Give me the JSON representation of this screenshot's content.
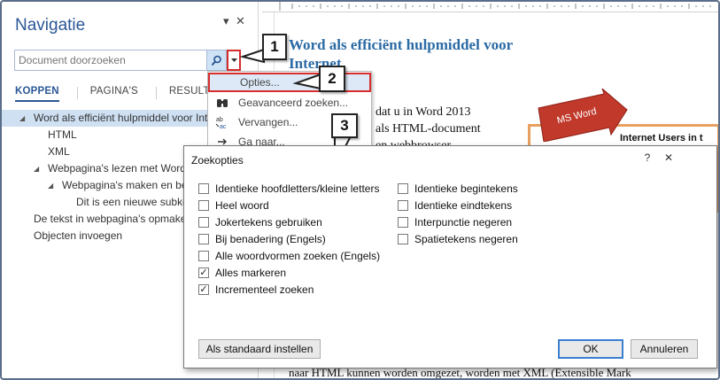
{
  "nav": {
    "title": "Navigatie",
    "dropdown_glyph": "▾",
    "close_glyph": "✕",
    "search_placeholder": "Document doorzoeken",
    "tabs": [
      "KOPPEN",
      "PAGINA'S",
      "RESULTATEN"
    ],
    "tree": [
      {
        "label": "Word als efficiënt hulpmiddel voor Internet",
        "expanded": true,
        "selected": true
      },
      {
        "label": "HTML"
      },
      {
        "label": "XML"
      },
      {
        "label": "Webpagina's lezen met Word",
        "expanded": true
      },
      {
        "label": "Webpagina's maken en bewerken",
        "expanded": true
      },
      {
        "label": "Dit is een nieuwe subkop"
      },
      {
        "label": "De tekst in webpagina's opmaken"
      },
      {
        "label": "Objecten invoegen"
      }
    ]
  },
  "menu": {
    "items": [
      {
        "label": "Opties...",
        "icon": "none",
        "highlighted": true
      },
      {
        "label": "Geavanceerd zoeken...",
        "icon": "binoculars-icon"
      },
      {
        "label": "Vervangen...",
        "icon": "replace-icon"
      },
      {
        "label": "Ga naar...",
        "icon": "arrow-icon"
      }
    ]
  },
  "document": {
    "title_line1": "Word als efficiënt hulpmiddel voor",
    "title_line2": "Internet",
    "line1": "dat u in Word 2013",
    "line2": "als HTML-document",
    "line3": "en webbrowser",
    "bottom_line": "naar HTML kunnen worden omgezet, worden met XML (Extensible Mark",
    "banner": "MS Word",
    "image_title": "Internet Users in t"
  },
  "callouts": [
    "1",
    "2",
    "3"
  ],
  "dialog": {
    "title": "Zoekopties",
    "help": "?",
    "close": "✕",
    "left_options": [
      {
        "label": "Identieke hoofdletters/kleine letters",
        "checked": false
      },
      {
        "label": "Heel woord",
        "checked": false
      },
      {
        "label": "Jokertekens gebruiken",
        "checked": false
      },
      {
        "label": "Bij benadering (Engels)",
        "checked": false
      },
      {
        "label": "Alle woordvormen zoeken (Engels)",
        "checked": false
      },
      {
        "label": "Alles markeren",
        "checked": true
      },
      {
        "label": "Incrementeel zoeken",
        "checked": true
      }
    ],
    "right_options": [
      {
        "label": "Identieke begintekens",
        "checked": false
      },
      {
        "label": "Identieke eindtekens",
        "checked": false
      },
      {
        "label": "Interpunctie negeren",
        "checked": false
      },
      {
        "label": "Spatietekens negeren",
        "checked": false
      }
    ],
    "check_glyph": "✓",
    "buttons": {
      "defaults": "Als standaard instellen",
      "ok": "OK",
      "cancel": "Annuleren"
    }
  },
  "colors": {
    "accent": "#2b5797",
    "highlight": "#d62d2d",
    "banner": "#c0392b"
  }
}
